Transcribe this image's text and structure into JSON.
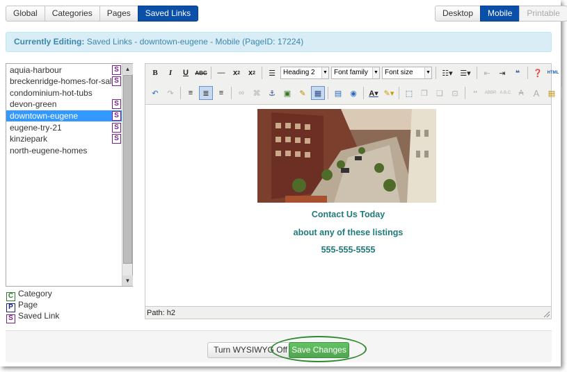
{
  "top_tabs": [
    "Global",
    "Categories",
    "Pages",
    "Saved Links"
  ],
  "active_tab": "Saved Links",
  "view_tabs": [
    "Desktop",
    "Mobile",
    "Printable"
  ],
  "active_view": "Mobile",
  "editing": {
    "label": "Currently Editing:",
    "value": "Saved Links - downtown-eugene - Mobile (PageID: 17224)"
  },
  "links": [
    {
      "name": "aquia-harbour",
      "badge": "S"
    },
    {
      "name": "breckenridge-homes-for-sale",
      "badge": "S"
    },
    {
      "name": "condominium-hot-tubs",
      "badge": ""
    },
    {
      "name": "devon-green",
      "badge": "S"
    },
    {
      "name": "downtown-eugene",
      "badge": "S",
      "selected": true
    },
    {
      "name": "eugene-try-21",
      "badge": "S"
    },
    {
      "name": "kinziepark",
      "badge": "S"
    },
    {
      "name": "north-eugene-homes",
      "badge": ""
    }
  ],
  "legend": [
    {
      "key": "C",
      "label": "Category",
      "color": "#2e7d32"
    },
    {
      "key": "P",
      "label": "Page",
      "color": "#1a237e"
    },
    {
      "key": "S",
      "label": "Saved Link",
      "color": "#7a1f8e"
    }
  ],
  "toolbar": {
    "format_select": "Heading 2",
    "font_family": "Font family",
    "font_size": "Font size"
  },
  "content": {
    "line1": "Contact Us Today",
    "line2": "about any of these listings",
    "line3": "555-555-5555"
  },
  "path": "Path: h2",
  "buttons": {
    "wysiwyg_off": "Turn WYSIWYG Off",
    "save": "Save Changes"
  },
  "colors": {
    "accent": "#0a4fa8",
    "info_bg": "#d9edf7",
    "selected_row": "#3399ff",
    "save_green": "#51a351",
    "heading_teal": "#1f7a7a"
  }
}
